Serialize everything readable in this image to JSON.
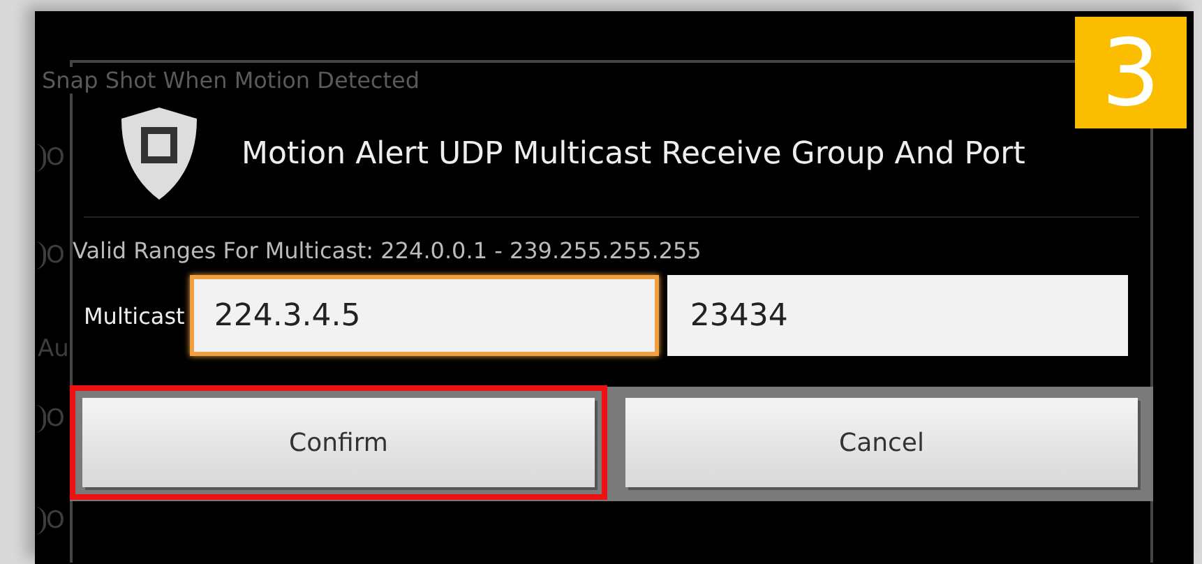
{
  "background": {
    "heading": "Snap Shot When Motion Detected",
    "fragments": [
      {
        "kind": "radio",
        "text": "O"
      },
      {
        "kind": "radio",
        "text": "O"
      },
      {
        "kind": "label",
        "text": "Au"
      },
      {
        "kind": "radio",
        "text": "O"
      },
      {
        "kind": "radio",
        "text": "O"
      }
    ]
  },
  "dialog": {
    "title": "Motion Alert UDP Multicast Receive Group And Port",
    "hint": "Valid Ranges For Multicast: 224.0.0.1 - 239.255.255.255",
    "field_label": "Multicast",
    "fields": [
      {
        "value": "224.3.4.5",
        "focused": true
      },
      {
        "value": "23434",
        "focused": false
      }
    ],
    "buttons": [
      {
        "label": "Confirm",
        "highlighted": true
      },
      {
        "label": "Cancel",
        "highlighted": false
      }
    ]
  },
  "step_badge": "3"
}
